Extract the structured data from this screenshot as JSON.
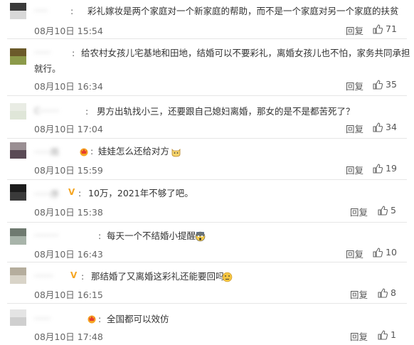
{
  "comments": [
    {
      "user": "·····",
      "text": "彩礼嫁妆是两个家庭对一个新家庭的帮助，而不是一个家庭对另一个家庭的扶贫",
      "time": "08月10日 15:54",
      "reply": "回复",
      "likes": "71"
    },
    {
      "user": "······",
      "text_line1": "给农村女孩儿宅基地和田地，结婚可以不要彩礼，离婚女孩儿也不怕，家务共同承担",
      "text_line2": "就行。",
      "time": "08月10日 16:34",
      "reply": "回复",
      "likes": "35"
    },
    {
      "user": "C·······",
      "text": "男方出轨找小三，还要跟自己媳妇离婚，那女的是不是都苦死了？",
      "time": "08月10日 17:04",
      "reply": "回复",
      "likes": "34"
    },
    {
      "user": "······雨",
      "text": "娃娃怎么还给对方",
      "time": "08月10日 15:59",
      "reply": "回复",
      "likes": "19"
    },
    {
      "user": "······序",
      "text": "10万，2021年不够了吧。",
      "time": "08月10日 15:38",
      "reply": "回复",
      "likes": "5"
    },
    {
      "user": "·········",
      "text": "每天一个不结婚小提醒",
      "time": "08月10日 16:43",
      "reply": "回复",
      "likes": "10"
    },
    {
      "user": "·······",
      "text": "那结婚了又离婚这彩礼还能要回吗",
      "time": "08月10日 16:15",
      "reply": "回复",
      "likes": "8"
    },
    {
      "user": "······",
      "text": "全国都可以效仿",
      "time": "08月10日 17:48",
      "reply": "回复",
      "likes": "1"
    }
  ],
  "colors": {
    "badge_gold": "#f5a623",
    "text": "#333333",
    "muted": "#666666"
  }
}
